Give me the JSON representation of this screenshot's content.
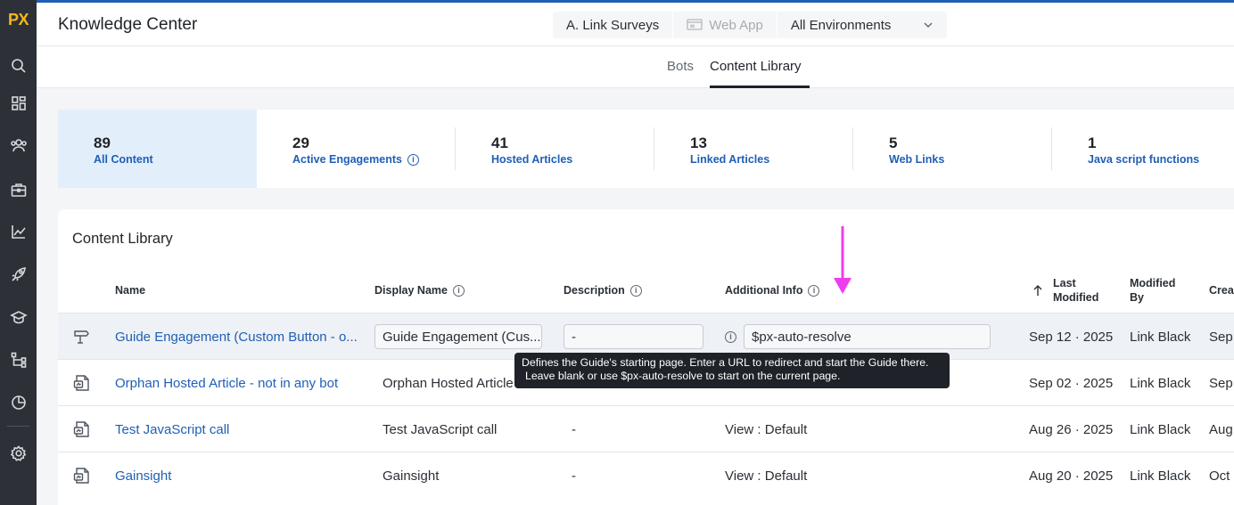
{
  "app": {
    "logo": "PX",
    "title": "Knowledge Center"
  },
  "header": {
    "product": "A. Link Surveys",
    "channel": "Web App",
    "environment": "All Environments"
  },
  "tabs": [
    {
      "label": "Bots"
    },
    {
      "label": "Content Library",
      "active": true
    }
  ],
  "stats": [
    {
      "count": "89",
      "label": "All Content"
    },
    {
      "count": "29",
      "label": "Active Engagements"
    },
    {
      "count": "41",
      "label": "Hosted Articles"
    },
    {
      "count": "13",
      "label": "Linked Articles"
    },
    {
      "count": "5",
      "label": "Web Links"
    },
    {
      "count": "1",
      "label": "Java script functions"
    }
  ],
  "library": {
    "title": "Content Library",
    "columns": {
      "name": "Name",
      "display_name": "Display Name",
      "description": "Description",
      "additional_info": "Additional Info",
      "last_modified": "Last Modified",
      "modified_by": "Modified By",
      "created": "Crea"
    },
    "rows": [
      {
        "icon": "signpost-icon",
        "name": "Guide Engagement (Custom Button - o...",
        "display_name": "Guide Engagement (Cus...",
        "description": "-",
        "additional_info": "$px-auto-resolve",
        "last_modified": "Sep 12 · 2025",
        "modified_by": "Link Black",
        "created": "Sep"
      },
      {
        "icon": "article-icon",
        "name": "Orphan Hosted Article - not in any bot",
        "display_name": "Orphan Hosted Article",
        "description": "",
        "additional_info": "",
        "last_modified": "Sep 02 · 2025",
        "modified_by": "Link Black",
        "created": "Sep"
      },
      {
        "icon": "article-icon",
        "name": "Test JavaScript call",
        "display_name": "Test JavaScript call",
        "description": "-",
        "additional_info": "View : Default",
        "last_modified": "Aug 26 · 2025",
        "modified_by": "Link Black",
        "created": "Aug"
      },
      {
        "icon": "article-icon",
        "name": "Gainsight",
        "display_name": "Gainsight",
        "description": "-",
        "additional_info": "View : Default",
        "last_modified": "Aug 20 · 2025",
        "modified_by": "Link Black",
        "created": "Oct"
      }
    ]
  },
  "tooltip": {
    "line1": "Defines the Guide's starting page. Enter a URL to redirect and start the Guide there.",
    "line2": "Leave blank or use $px-auto-resolve to start on the current page."
  },
  "colors": {
    "accent": "#1f5fb6",
    "rail": "#2d3137",
    "logo": "#f5b71a",
    "arrow": "#f03cf0"
  }
}
